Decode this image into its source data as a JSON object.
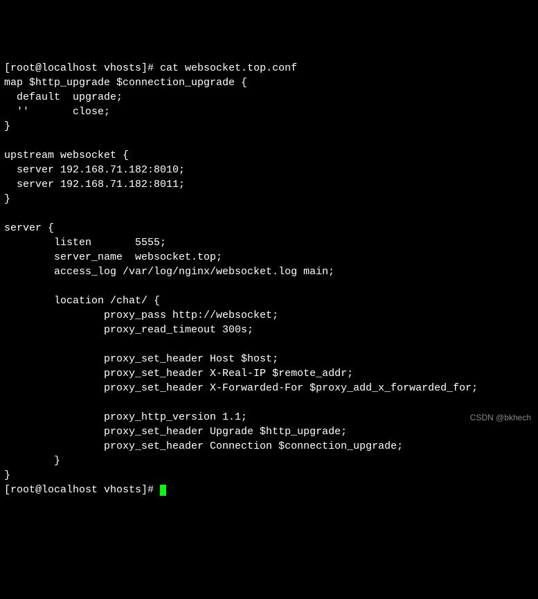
{
  "terminal": {
    "prompt1": "[root@localhost vhosts]# ",
    "command1": "cat websocket.top.conf",
    "config_lines": [
      "map $http_upgrade $connection_upgrade {",
      "  default  upgrade;",
      "  ''       close;",
      "}",
      "",
      "upstream websocket {",
      "  server 192.168.71.182:8010;",
      "  server 192.168.71.182:8011;",
      "}",
      "",
      "server {",
      "        listen       5555;",
      "        server_name  websocket.top;",
      "        access_log /var/log/nginx/websocket.log main;",
      "",
      "        location /chat/ {",
      "                proxy_pass http://websocket;",
      "                proxy_read_timeout 300s;",
      "",
      "                proxy_set_header Host $host;",
      "                proxy_set_header X-Real-IP $remote_addr;",
      "                proxy_set_header X-Forwarded-For $proxy_add_x_forwarded_for;",
      "",
      "                proxy_http_version 1.1;",
      "                proxy_set_header Upgrade $http_upgrade;",
      "                proxy_set_header Connection $connection_upgrade;",
      "        }",
      "}"
    ],
    "prompt2": "[root@localhost vhosts]# "
  },
  "watermark": "CSDN @bkhech"
}
